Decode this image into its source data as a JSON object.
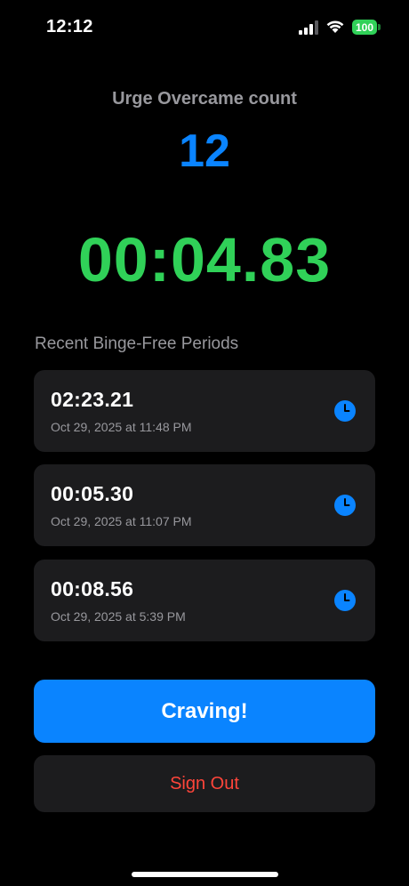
{
  "status_bar": {
    "time": "12:12",
    "battery": "100",
    "battery_color": "#30d158"
  },
  "counter": {
    "label": "Urge Overcame count",
    "value": "12",
    "color": "#0a84ff"
  },
  "timer": {
    "value": "00:04.83",
    "color": "#30d158"
  },
  "recent": {
    "title": "Recent Binge-Free Periods",
    "items": [
      {
        "duration": "02:23.21",
        "date": "Oct 29, 2025 at 11:48 PM",
        "icon": "clock-icon"
      },
      {
        "duration": "00:05.30",
        "date": "Oct 29, 2025 at 11:07 PM",
        "icon": "clock-icon"
      },
      {
        "duration": "00:08.56",
        "date": "Oct 29, 2025 at 5:39 PM",
        "icon": "clock-icon"
      }
    ]
  },
  "actions": {
    "craving_label": "Craving!",
    "signout_label": "Sign Out",
    "accent": "#0a84ff",
    "destructive": "#ff453a"
  }
}
